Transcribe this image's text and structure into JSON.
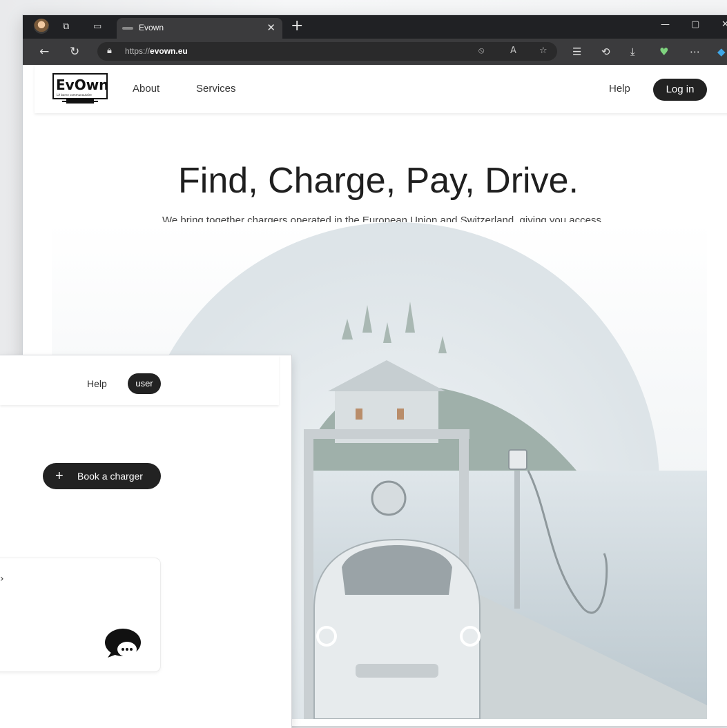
{
  "browser": {
    "tab_title": "Evown",
    "url_prefix": "https://",
    "url_host": "evown.eu"
  },
  "site": {
    "nav": [
      "About",
      "Services"
    ],
    "help": "Help",
    "login": "Log in"
  },
  "hero": {
    "title": "Find, Charge, Pay, Drive.",
    "subtitle": "We bring together chargers operated in the European Union and Switzerland, giving you access to the largest and fastest growing EV charging network - all in one place."
  },
  "panel": {
    "help": "Help",
    "user": "user",
    "book_plus": "+",
    "book_label": "Book a charger",
    "card_chevron": "›"
  },
  "logo": {
    "text_top": "EvOwn",
    "text_small": "LA borne communautaire"
  }
}
